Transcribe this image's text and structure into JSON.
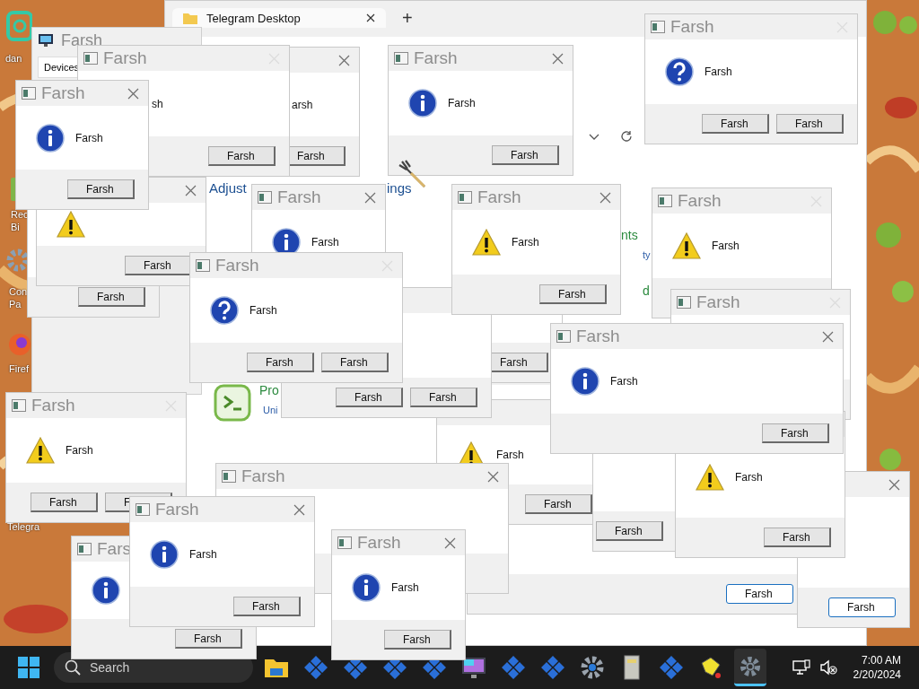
{
  "desktop_icons": [
    {
      "kind": "folder",
      "lines": [
        "dan"
      ]
    },
    {
      "kind": "bin",
      "lines": [
        "Rec",
        "Bi"
      ]
    },
    {
      "kind": "gear",
      "lines": [
        "Con",
        "Pa"
      ]
    },
    {
      "kind": "browser",
      "lines": [
        "Firef"
      ]
    },
    {
      "kind": "app",
      "lines": [
        "Telegra"
      ]
    }
  ],
  "browser_window": {
    "tab": "Telegram Desktop",
    "new_tab": "+",
    "content": [
      {
        "text": "Adjust",
        "kind": "heading_link"
      },
      {
        "text": "ings",
        "kind": "heading_link"
      },
      {
        "text": "nts",
        "kind": "heading"
      },
      {
        "text": "ty",
        "kind": "link"
      },
      {
        "text": "d",
        "kind": "heading"
      },
      {
        "text": "Pro",
        "kind": "heading"
      },
      {
        "text": "Uni",
        "kind": "link"
      }
    ]
  },
  "settings_window": {
    "title": "Farsh",
    "tab": "Devices"
  },
  "dialogs": [
    {
      "title": "Farsh",
      "close": {
        "disabled": true
      },
      "kind": "question",
      "message": "Farsh",
      "buttons": [
        {
          "label": "Farsh",
          "focused": false
        },
        {
          "label": "Farsh",
          "focused": false
        }
      ]
    },
    {
      "title": "Farsh",
      "close": {
        "disabled": true
      },
      "message": "sh",
      "buttons": [
        {
          "label": "Farsh",
          "focused": false
        }
      ]
    },
    {
      "close": {
        "disabled": false
      },
      "message": "arsh",
      "buttons": [
        {
          "label": "Farsh",
          "focused": false
        }
      ]
    },
    {
      "title": "Farsh",
      "close": {
        "disabled": false
      },
      "kind": "info",
      "message": "Farsh",
      "buttons": [
        {
          "label": "Farsh",
          "focused": false
        }
      ]
    },
    {
      "title": "Farsh",
      "close": {
        "disabled": false
      },
      "kind": "info",
      "message": "Farsh",
      "buttons": [
        {
          "label": "Farsh",
          "focused": false
        }
      ]
    },
    {
      "close": {
        "disabled": false
      },
      "kind": "warning",
      "buttons": [
        {
          "label": "Farsh",
          "focused": false
        }
      ]
    },
    {
      "buttons": [
        {
          "label": "Farsh",
          "focused": false
        }
      ]
    },
    {
      "title": "Farsh",
      "close": {
        "disabled": false
      },
      "kind": "info",
      "message": "Farsh"
    },
    {
      "title": "Farsh",
      "close": {
        "disabled": false
      },
      "kind": "warning",
      "message": "Farsh",
      "buttons": [
        {
          "label": "Farsh",
          "focused": false
        }
      ]
    },
    {
      "title": "Farsh",
      "close": {
        "disabled": true
      },
      "kind": "warning",
      "message": "Farsh"
    },
    {
      "title": "Farsh",
      "close": {
        "disabled": true
      },
      "kind": "question",
      "message": "Farsh",
      "buttons": [
        {
          "label": "Farsh",
          "focused": false
        },
        {
          "label": "Farsh",
          "focused": false
        }
      ]
    },
    {
      "buttons": [
        {
          "label": "Farsh",
          "focused": false
        }
      ]
    },
    {
      "buttons": [
        {
          "label": "Farsh",
          "focused": false
        },
        {
          "label": "Farsh",
          "focused": false
        }
      ]
    },
    {
      "title": "Farsh",
      "close": {
        "disabled": true
      }
    },
    {
      "title": "Farsh",
      "close": {
        "disabled": false
      },
      "kind": "info",
      "message": "Farsh",
      "buttons": [
        {
          "label": "Farsh",
          "focused": false
        }
      ]
    },
    {
      "buttons": [
        {
          "label": "Farsh",
          "focused": true
        }
      ]
    },
    {
      "title": "Farsh",
      "close": {
        "disabled": true
      },
      "kind": "warning",
      "message": "Farsh",
      "buttons": [
        {
          "label": "Farsh",
          "focused": false
        },
        {
          "label": "F",
          "focused": false
        }
      ]
    },
    {
      "kind": "warning",
      "message": "Farsh",
      "buttons": [
        {
          "label": "Farsh",
          "focused": false
        }
      ]
    },
    {
      "kind": "warning",
      "message": "Farsh",
      "buttons": [
        {
          "label": "Farsh",
          "focused": false
        }
      ]
    },
    {
      "buttons": [
        {
          "label": "Farsh",
          "focused": false
        }
      ]
    },
    {
      "title": "Farsh",
      "close": {
        "disabled": false
      }
    },
    {
      "close": {
        "disabled": false
      },
      "buttons": [
        {
          "label": "Farsh",
          "focused": true
        }
      ]
    },
    {
      "title": "Farsh",
      "close": {
        "disabled": false
      },
      "kind": "info",
      "message": "Farsh",
      "buttons": [
        {
          "label": "Farsh",
          "focused": false
        }
      ]
    },
    {
      "title": "Fars",
      "kind": "info",
      "buttons": [
        {
          "label": "Farsh",
          "focused": false
        }
      ]
    },
    {
      "title": "Farsh",
      "close": {
        "disabled": false
      },
      "kind": "info",
      "message": "Farsh",
      "buttons": [
        {
          "label": "Farsh",
          "focused": false
        }
      ]
    }
  ],
  "taskbar": {
    "search": {
      "placeholder": "Search"
    },
    "apps": [
      {
        "kind": "folder",
        "active": false
      },
      {
        "kind": "diamond",
        "active": false
      },
      {
        "kind": "diamond",
        "active": false
      },
      {
        "kind": "diamond",
        "active": false
      },
      {
        "kind": "diamond",
        "active": false
      },
      {
        "kind": "monitor",
        "active": false
      },
      {
        "kind": "diamond",
        "active": false
      },
      {
        "kind": "diamond",
        "active": false
      },
      {
        "kind": "gear",
        "active": false
      },
      {
        "kind": "cabinet",
        "active": false
      },
      {
        "kind": "diamond",
        "active": false
      },
      {
        "kind": "hand",
        "active": false
      },
      {
        "kind": "settings",
        "active": true
      }
    ],
    "time": "7:00 AM",
    "date": "2/20/2024"
  }
}
